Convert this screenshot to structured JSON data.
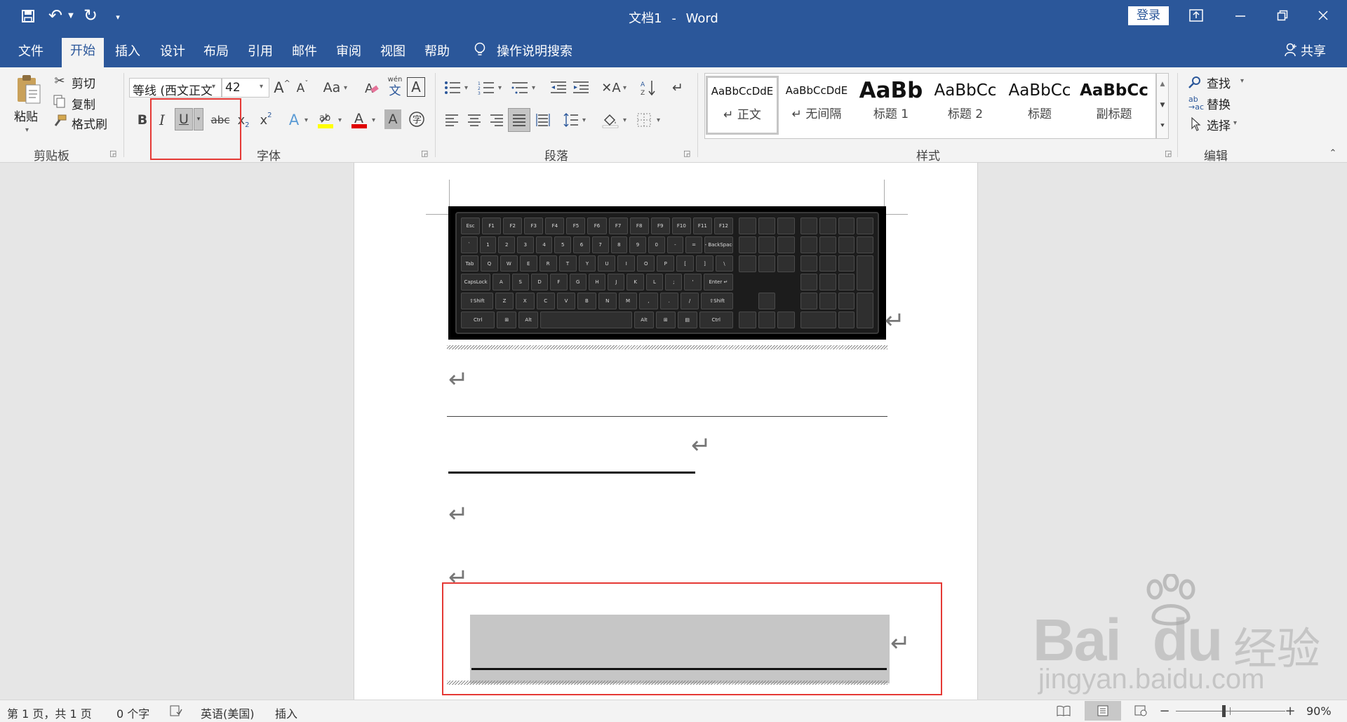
{
  "titlebar": {
    "doc_title": "文档1",
    "separator": "-",
    "app_name": "Word",
    "login_label": "登录",
    "share_label": "共享"
  },
  "tabs": [
    {
      "label": "文件"
    },
    {
      "label": "开始"
    },
    {
      "label": "插入"
    },
    {
      "label": "设计"
    },
    {
      "label": "布局"
    },
    {
      "label": "引用"
    },
    {
      "label": "邮件"
    },
    {
      "label": "审阅"
    },
    {
      "label": "视图"
    },
    {
      "label": "帮助"
    }
  ],
  "search": {
    "label": "操作说明搜索"
  },
  "clipboard": {
    "paste": "粘贴",
    "cut": "剪切",
    "copy": "复制",
    "format_painter": "格式刷",
    "group_label": "剪贴板"
  },
  "font": {
    "family": "等线 (西文正文",
    "size": "42",
    "group_label": "字体",
    "bold": "B",
    "italic": "I",
    "underline": "U",
    "strike": "abc",
    "subscript": "x",
    "superscript": "x",
    "case": "Aa",
    "phonetic_top": "wén",
    "phonetic_bottom": "文"
  },
  "paragraph": {
    "group_label": "段落"
  },
  "styles": {
    "group_label": "样式",
    "items": [
      {
        "preview": "AaBbCcDdE",
        "name": "正文"
      },
      {
        "preview": "AaBbCcDdE",
        "name": "无间隔"
      },
      {
        "preview": "AaBb",
        "name": "标题 1"
      },
      {
        "preview": "AaBbCc",
        "name": "标题 2"
      },
      {
        "preview": "AaBbCc",
        "name": "标题"
      },
      {
        "preview": "AaBbCc",
        "name": "副标题"
      }
    ]
  },
  "editing": {
    "find": "查找",
    "replace": "替换",
    "select": "选择",
    "group_label": "编辑"
  },
  "status": {
    "page": "第 1 页，共 1 页",
    "words": "0 个字",
    "language": "英语(美国)",
    "mode": "插入",
    "zoom": "90%"
  },
  "keyboard": {
    "rows": [
      [
        "Esc",
        "F1",
        "F2",
        "F3",
        "F4",
        "F5",
        "F6",
        "F7",
        "F8",
        "F9",
        "F10",
        "F11",
        "F12"
      ],
      [
        "`",
        "1",
        "2",
        "3",
        "4",
        "5",
        "6",
        "7",
        "8",
        "9",
        "0",
        "-",
        "=",
        "← BackSpace"
      ],
      [
        "Tab",
        "Q",
        "W",
        "E",
        "R",
        "T",
        "Y",
        "U",
        "I",
        "O",
        "P",
        "[",
        "]",
        "\\"
      ],
      [
        "CapsLock",
        "A",
        "S",
        "D",
        "F",
        "G",
        "H",
        "J",
        "K",
        "L",
        ";",
        "'",
        "Enter ↵"
      ],
      [
        "⇧Shift",
        "Z",
        "X",
        "C",
        "V",
        "B",
        "N",
        "M",
        ",",
        ".",
        "/",
        "⇧Shift"
      ],
      [
        "Ctrl",
        "⊞",
        "Alt",
        "",
        "Alt",
        "⊞",
        "▤",
        "Ctrl"
      ]
    ]
  },
  "watermark": {
    "brand": "Bai",
    "brand2": "du",
    "suffix": "经验",
    "url": "jingyan.baidu.com"
  }
}
